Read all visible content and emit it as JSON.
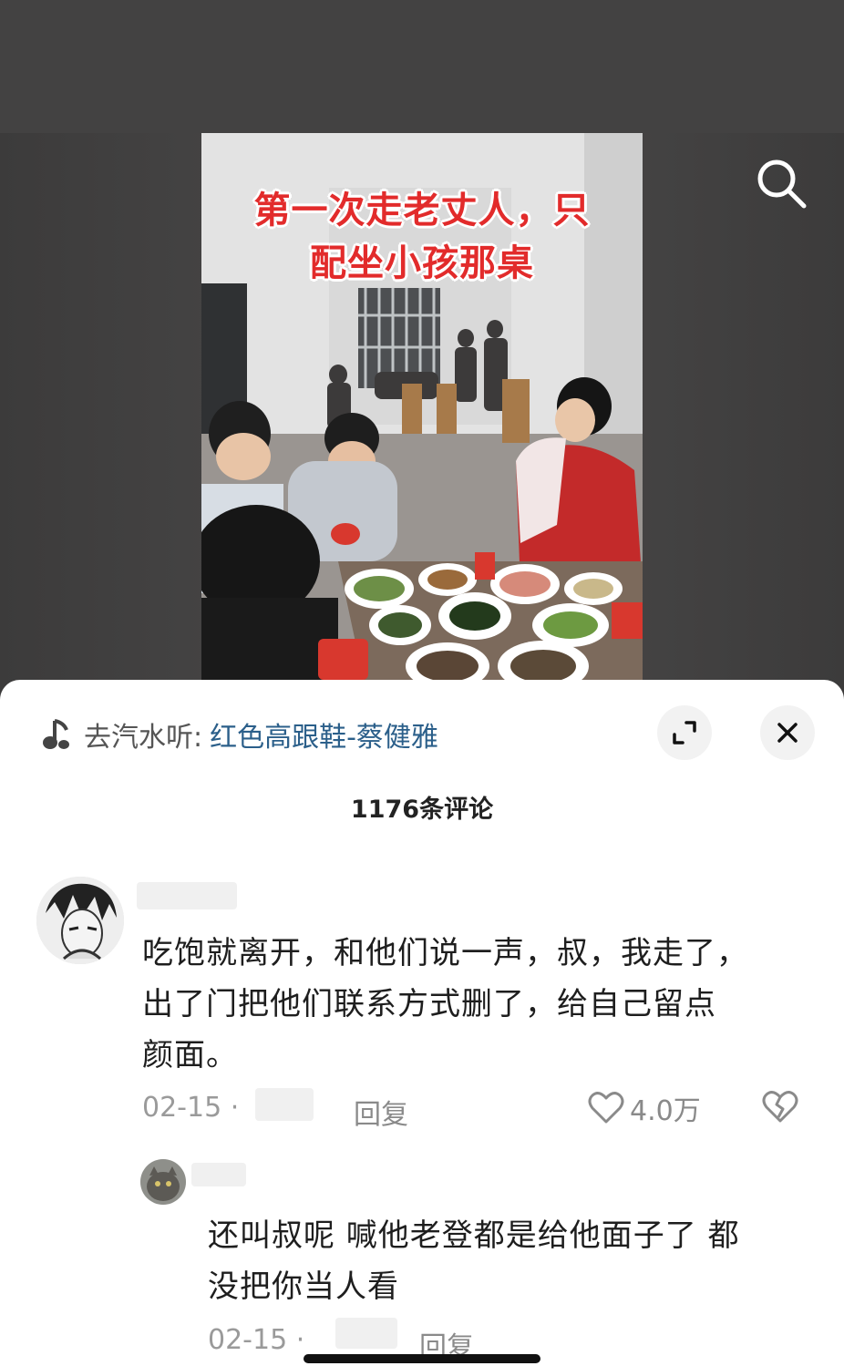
{
  "video": {
    "caption_line1": "第一次走老丈人，只",
    "caption_line2": "配坐小孩那桌",
    "search_icon": "search-icon"
  },
  "sheet": {
    "music_prefix": "去汽水听:",
    "music_title": "红色高跟鞋-蔡健雅",
    "expand_icon": "expand-icon",
    "close_icon": "close-icon",
    "comment_count": "1176条评论"
  },
  "comments": [
    {
      "line1": "吃饱就离开，和他们说一声，叔，我走了，",
      "line2": "出了门把他们联系方式删了，给自己留点",
      "line3": "颜面。",
      "date": "02-15 ·",
      "reply_label": "回复",
      "likes": "4.0万"
    }
  ],
  "replies": [
    {
      "line1": "还叫叔呢 喊他老登都是给他面子了 都",
      "line2": "没把你当人看",
      "date": "02-15 ·",
      "reply_label": "回复"
    }
  ]
}
